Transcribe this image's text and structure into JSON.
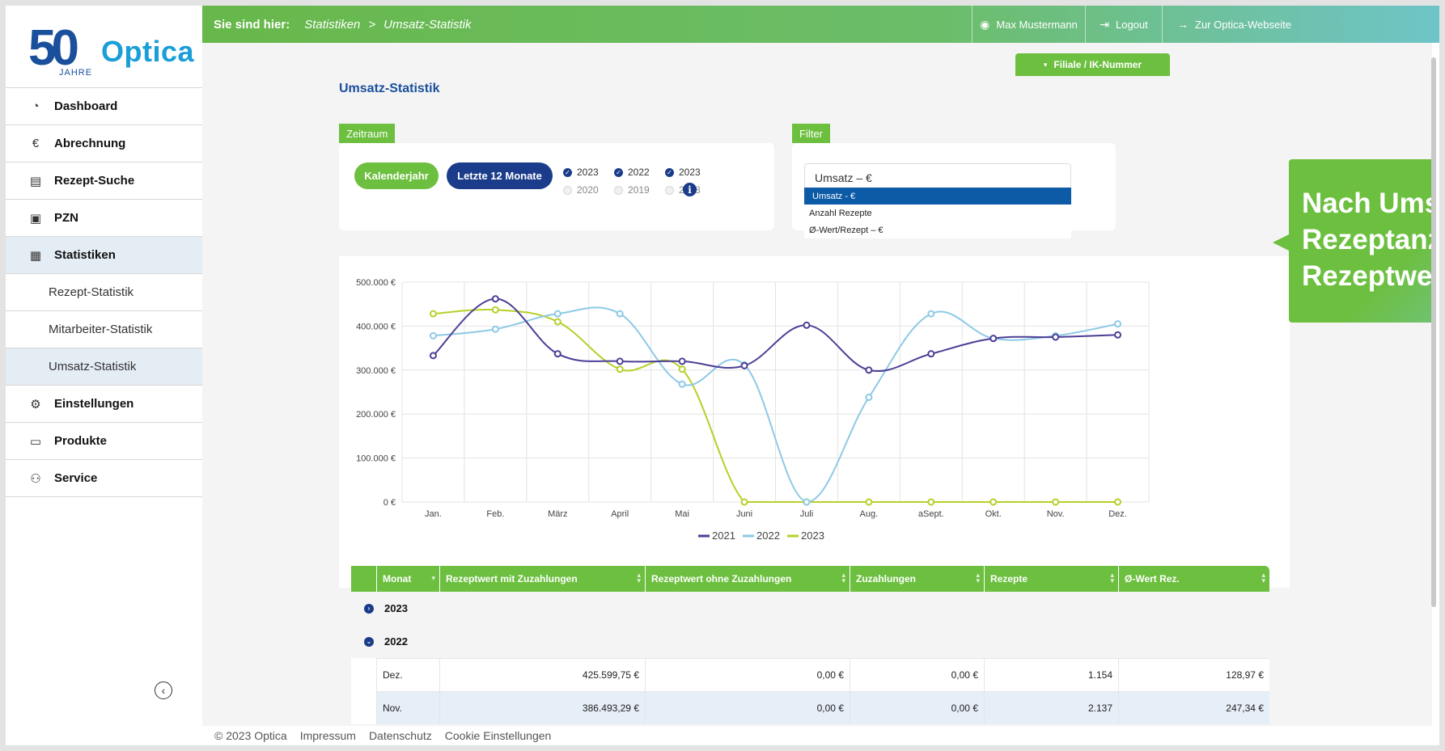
{
  "logo": {
    "number": "50",
    "jahre": "JAHRE",
    "brand": "Optica"
  },
  "topbar": {
    "label": "Sie sind hier:",
    "crumbs": [
      "Statistiken",
      "Umsatz-Statistik"
    ],
    "separator": ">",
    "user": "Max Mustermann",
    "logout": "Logout",
    "website": "Zur Optica-Webseite"
  },
  "sidebar": {
    "items": [
      {
        "label": "Dashboard",
        "icon": "dashboard-icon"
      },
      {
        "label": "Abrechnung",
        "icon": "euro-icon"
      },
      {
        "label": "Rezept-Suche",
        "icon": "prescription-search-icon"
      },
      {
        "label": "PZN",
        "icon": "pzn-icon"
      },
      {
        "label": "Statistiken",
        "icon": "statistics-icon"
      },
      {
        "label": "Rezept-Statistik"
      },
      {
        "label": "Mitarbeiter-Statistik"
      },
      {
        "label": "Umsatz-Statistik"
      },
      {
        "label": "Einstellungen",
        "icon": "settings-icon"
      },
      {
        "label": "Produkte",
        "icon": "products-icon"
      },
      {
        "label": "Service",
        "icon": "service-icon"
      }
    ]
  },
  "filiale_button": "Filiale / IK-Nummer",
  "page_title": "Umsatz-Statistik",
  "zeitraum": {
    "tag": "Zeitraum",
    "kalenderjahr": "Kalenderjahr",
    "letzte12": "Letzte 12 Monate",
    "years": [
      {
        "label": "2023",
        "checked": true
      },
      {
        "label": "2022",
        "checked": true
      },
      {
        "label": "2023",
        "checked": true
      },
      {
        "label": "2020",
        "checked": false
      },
      {
        "label": "2019",
        "checked": false
      },
      {
        "label": "2018",
        "checked": false
      }
    ]
  },
  "filter": {
    "tag": "Filter",
    "selected": "Umsatz – €",
    "options": [
      "Umsatz - €",
      "Anzahl Rezepte",
      "Ø-Wert/Rezept – €"
    ]
  },
  "callout": "Nach Umsatz, Rezeptanzahl oder Rezeptwert filtern",
  "colors": {
    "green": "#6cbf3f",
    "navy": "#1a3c8a",
    "blue": "#1a4f9c",
    "s2021": "#4b3f96",
    "s2022": "#8ec9e6",
    "s2023": "#b8cf2a"
  },
  "chart_data": {
    "type": "line",
    "categories": [
      "Jan.",
      "Feb.",
      "März",
      "April",
      "Mai",
      "Juni",
      "Juli",
      "Aug.",
      "aSept.",
      "Okt.",
      "Nov.",
      "Dez."
    ],
    "y_ticks": [
      "500.000 €",
      "400.000 €",
      "300.000 €",
      "200.000 €",
      "100.000 €",
      "0 €"
    ],
    "ylim": [
      0,
      500000
    ],
    "grid": true,
    "legend": "bottom-center",
    "series": [
      {
        "name": "2021",
        "color": "#4b3f96",
        "values": [
          333000,
          462000,
          337000,
          320000,
          320000,
          310000,
          402000,
          300000,
          337000,
          372000,
          375000,
          380000
        ]
      },
      {
        "name": "2022",
        "color": "#8ec9e6",
        "values": [
          378000,
          393000,
          428000,
          428000,
          268000,
          312000,
          0,
          238000,
          428000,
          372000,
          378000,
          405000
        ]
      },
      {
        "name": "2023",
        "color": "#b8cf2a",
        "values": [
          428000,
          437000,
          410000,
          302000,
          302000,
          0,
          0,
          0,
          0,
          0,
          0,
          0
        ]
      }
    ]
  },
  "table": {
    "headers": [
      "Monat",
      "Rezeptwert mit Zuzahlungen",
      "Rezeptwert ohne Zuzahlungen",
      "Zuzahlungen",
      "Rezepte",
      "Ø-Wert Rez."
    ],
    "groups": [
      {
        "year": "2023",
        "expanded": false
      },
      {
        "year": "2022",
        "expanded": true
      }
    ],
    "rows": [
      [
        "Dez.",
        "425.599,75 €",
        "0,00 €",
        "0,00 €",
        "1.154",
        "128,97 €"
      ],
      [
        "Nov.",
        "386.493,29 €",
        "0,00 €",
        "0,00 €",
        "2.137",
        "247,34 €"
      ]
    ]
  },
  "footer": {
    "copyright": "© 2023 Optica",
    "impressum": "Impressum",
    "datenschutz": "Datenschutz",
    "cookies": "Cookie Einstellungen"
  }
}
